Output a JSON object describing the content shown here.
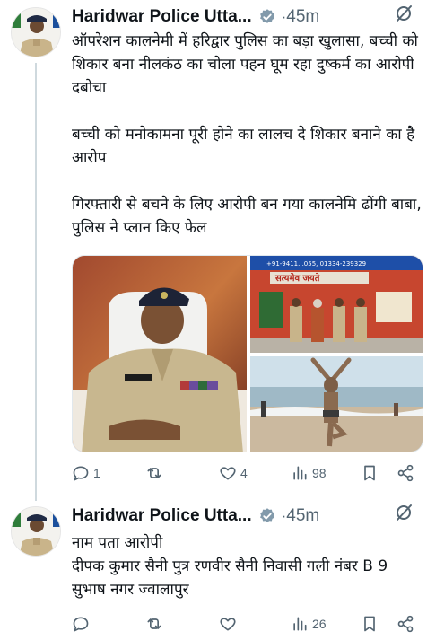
{
  "posts": [
    {
      "author": "Haridwar Police Utta...",
      "time": "45m",
      "text": "ऑपरेशन कालनेमी में हरिद्वार पुलिस का बड़ा खुलासा, बच्ची को शिकार बना नीलकंठ का चोला पहन घूम रहा दुष्कर्म का आरोपी दबोचा\n\nबच्ची को मनोकामना पूरी होने का लालच दे शिकार बनाने का है आरोप\n\nगिरफ्तारी से बचने के लिए आरोपी बन गया कालनेमि ढोंगी बाबा, पुलिस ने प्लान किए फेल",
      "media": {
        "banner_text": "सत्यमेव जयते",
        "banner_phone": "+91-9411...055, 01334-239329"
      },
      "stats": {
        "replies": "1",
        "reposts": "",
        "likes": "4",
        "views": "98"
      }
    },
    {
      "author": "Haridwar Police Utta...",
      "time": "45m",
      "text": "नाम पता आरोपी\nदीपक कुमार सैनी पुत्र रणवीर सैनी निवासी गली नंबर B 9 सुभाष नगर ज्वालापुर",
      "stats": {
        "replies": "",
        "reposts": "",
        "likes": "",
        "views": "26"
      }
    }
  ],
  "separator": "·",
  "icons": [
    "verified-badge-icon",
    "grok-icon",
    "reply-icon",
    "repost-icon",
    "like-icon",
    "views-icon",
    "bookmark-icon",
    "share-icon"
  ],
  "colors": {
    "verified": "#829aab",
    "text": "#0f1419",
    "muted": "#536471",
    "thread": "#cfd9de"
  }
}
